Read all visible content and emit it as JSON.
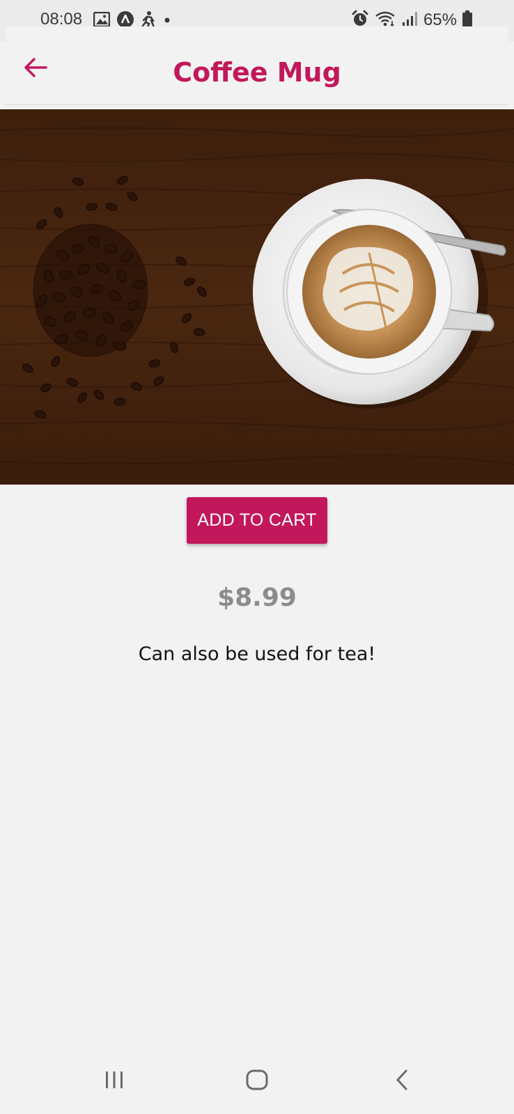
{
  "status_bar": {
    "time": "08:08",
    "battery": "65%",
    "left_icons": [
      "image-icon",
      "app-a-icon",
      "fitness-icon",
      "dot-icon"
    ],
    "right_icons": [
      "alarm-icon",
      "wifi-icon",
      "signal-icon",
      "battery-icon"
    ]
  },
  "header": {
    "title": "Coffee Mug",
    "back_icon": "arrow-left-icon"
  },
  "product": {
    "add_to_cart_label": "ADD TO CART",
    "price": "$8.99",
    "description": "Can also be used for tea!"
  },
  "colors": {
    "accent": "#c2185b",
    "background": "#f2f2f2",
    "price_text": "#8c8c8c"
  },
  "nav_bar": {
    "buttons": [
      "recent-apps-icon",
      "home-icon",
      "back-icon"
    ]
  }
}
